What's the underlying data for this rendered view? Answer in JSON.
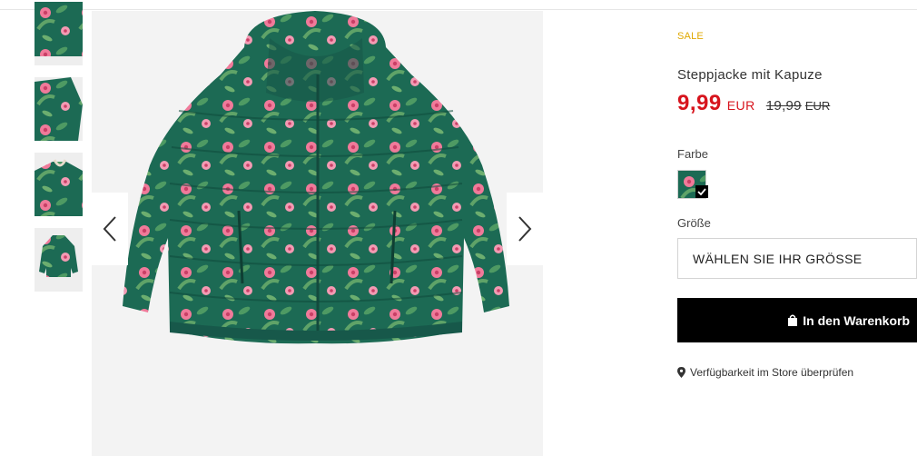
{
  "gallery": {
    "thumbnails": [
      "jacket-back-view",
      "jacket-detail-side",
      "jacket-collar-detail",
      "jacket-full-front"
    ],
    "main_image": "floral-puffer-jacket",
    "prev_icon": "chevron-left-icon",
    "next_icon": "chevron-right-icon"
  },
  "product": {
    "badge": "SALE",
    "title": "Steppjacke mit Kapuze",
    "price_new": "9,99",
    "price_new_currency": "EUR",
    "price_old": "19,99",
    "price_old_currency": "EUR",
    "color_label": "Farbe",
    "size_label": "Größe",
    "size_select_value": "WÄHLEN SIE IHR GRÖSSE",
    "cart_button": "In den Warenkorb",
    "store_link": "Verfügbarkeit im Store überprüfen"
  },
  "colors": {
    "sale": "#e0a800",
    "price": "#d7141d",
    "jacket_green": "#1d6b55",
    "flower_pink": "#f07a9a"
  }
}
